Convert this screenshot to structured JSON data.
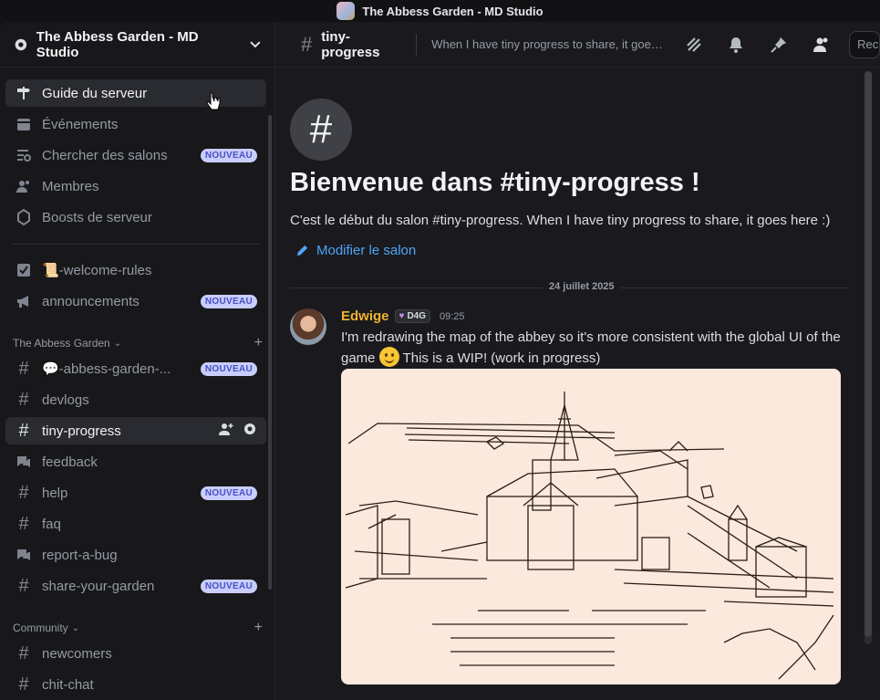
{
  "window": {
    "title": "The Abbess Garden - MD Studio"
  },
  "server": {
    "name": "The Abbess Garden - MD Studio"
  },
  "sidebar": {
    "top_items": [
      {
        "label": "Guide du serveur",
        "icon": "signpost-icon"
      },
      {
        "label": "Événements",
        "icon": "calendar-icon"
      },
      {
        "label": "Chercher des salons",
        "icon": "channel-search-icon",
        "badge": "NOUVEAU"
      },
      {
        "label": "Membres",
        "icon": "members-icon"
      },
      {
        "label": "Boosts de serveur",
        "icon": "boost-icon"
      }
    ],
    "channels_top": [
      {
        "label": "📜-welcome-rules",
        "icon": "rules-icon"
      },
      {
        "label": "announcements",
        "icon": "megaphone-icon",
        "badge": "NOUVEAU"
      }
    ],
    "category1": "The Abbess Garden",
    "category1_channels": [
      {
        "label": "💬-abbess-garden-...",
        "icon": "hash-icon",
        "badge": "NOUVEAU"
      },
      {
        "label": "devlogs",
        "icon": "hash-icon"
      },
      {
        "label": "tiny-progress",
        "icon": "hash-icon",
        "active": true
      },
      {
        "label": "feedback",
        "icon": "forum-icon"
      },
      {
        "label": "help",
        "icon": "hash-icon",
        "badge": "NOUVEAU"
      },
      {
        "label": "faq",
        "icon": "hash-icon"
      },
      {
        "label": "report-a-bug",
        "icon": "forum-icon"
      },
      {
        "label": "share-your-garden",
        "icon": "hash-icon",
        "badge": "NOUVEAU"
      }
    ],
    "category2": "Community",
    "category2_channels": [
      {
        "label": "newcomers",
        "icon": "hash-icon"
      },
      {
        "label": "chit-chat",
        "icon": "hash-icon"
      }
    ]
  },
  "channel": {
    "name": "tiny-progress",
    "topic": "When I have tiny progress to share, it goes he...",
    "search_placeholder": "Rech"
  },
  "welcome": {
    "title": "Bienvenue dans #tiny-progress !",
    "subtitle": "C'est le début du salon #tiny-progress. When I have tiny progress to share, it goes here :)",
    "edit_label": "Modifier le salon"
  },
  "date_divider": "24 juillet 2025",
  "message": {
    "author": "Edwige",
    "tag": "D4G",
    "time": "09:25",
    "text_part1": "I'm redrawing the map of the abbey so it's more consistent with the global UI of the game",
    "text_part2": " This is a WIP! (work in progress)"
  },
  "colors": {
    "accent": "#5865f2",
    "author": "#f0b232",
    "link": "#4fa3f7",
    "badge_bg": "#c9cdfb"
  }
}
